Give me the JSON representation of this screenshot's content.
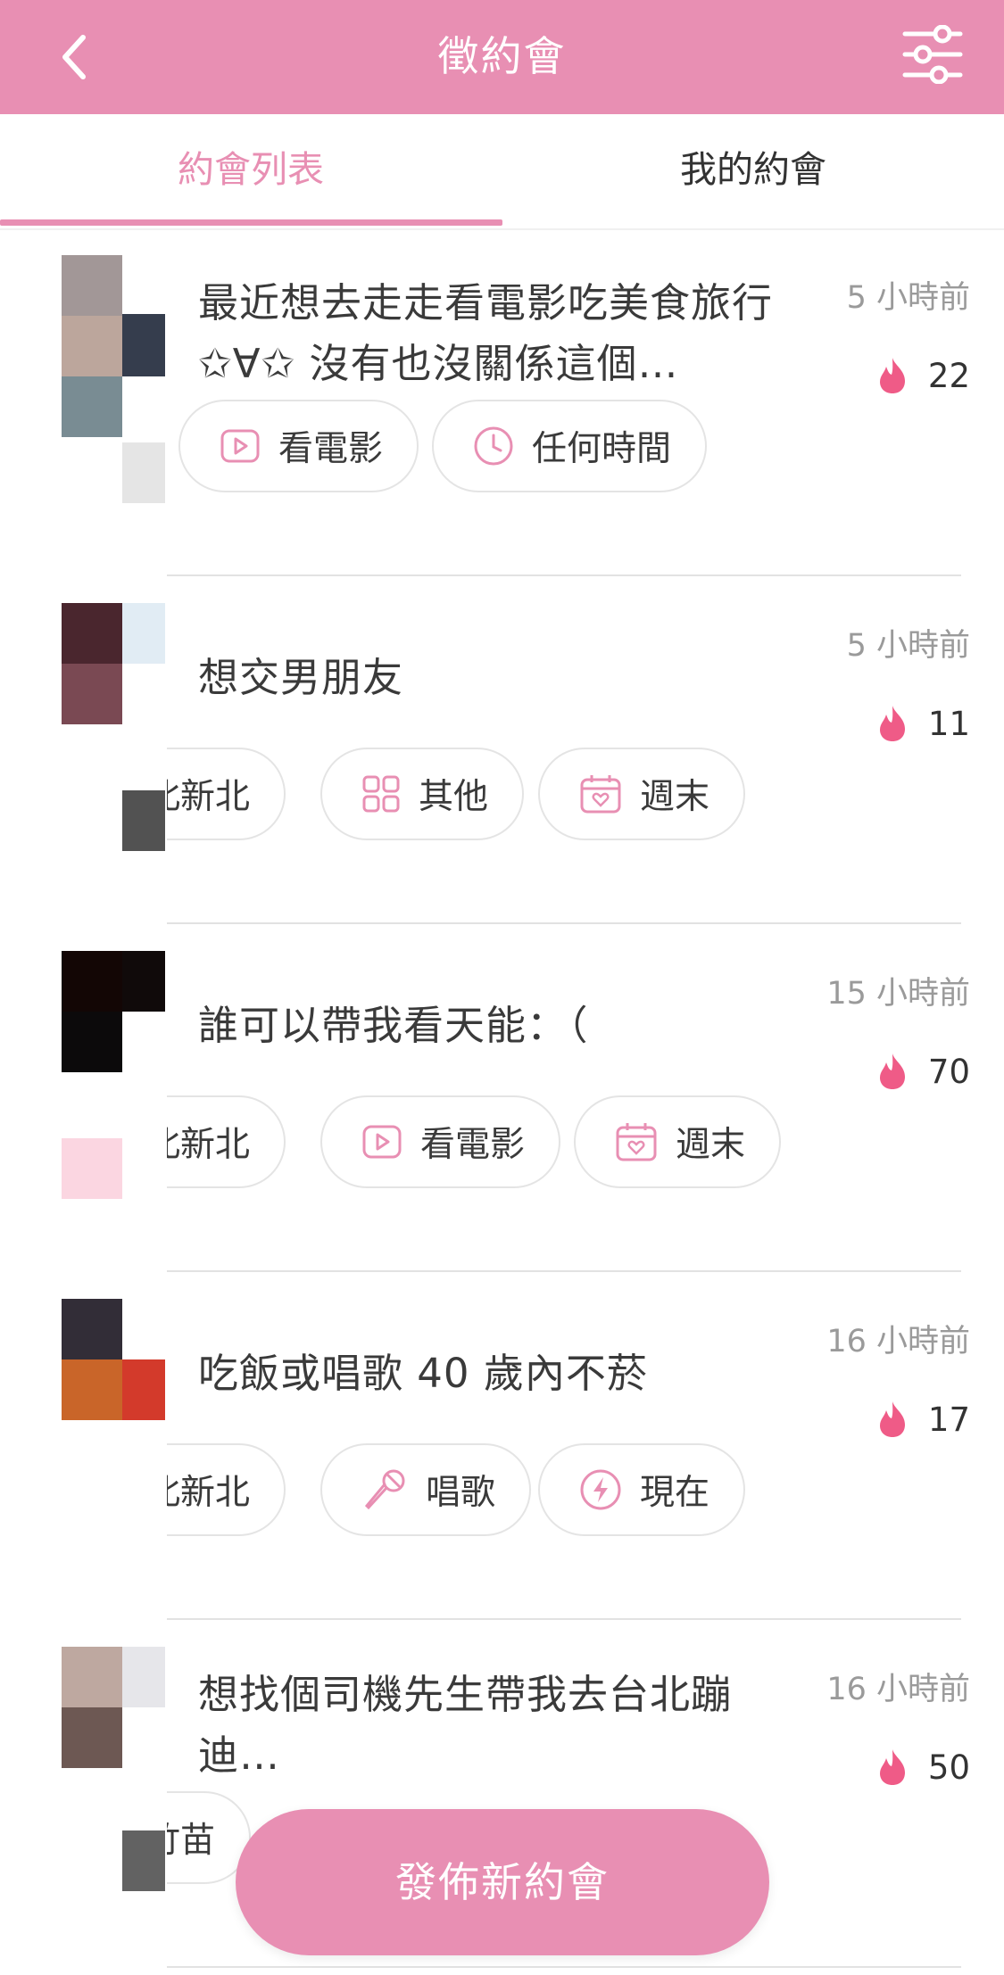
{
  "header": {
    "title": "徵約會",
    "back_icon": "chevron-left-icon",
    "filter_icon": "sliders-icon",
    "color": "#e88fb3"
  },
  "tabs": [
    {
      "label": "約會列表",
      "active": true
    },
    {
      "label": "我的約會",
      "active": false
    }
  ],
  "posts": [
    {
      "title": "最近想去走走看電影吃美食旅行 ✩∀✩ 沒有也沒關係這個…",
      "time": "5 小時前",
      "heat": "22",
      "tags": [
        {
          "label": "看電影",
          "icon": "play-icon"
        },
        {
          "label": "任何時間",
          "icon": "clock-icon"
        }
      ]
    },
    {
      "title": "想交男朋友",
      "time": "5 小時前",
      "heat": "11",
      "tags": [
        {
          "label": "北新北",
          "icon": ""
        },
        {
          "label": "其他",
          "icon": "grid-icon"
        },
        {
          "label": "週末",
          "icon": "calendar-icon"
        }
      ]
    },
    {
      "title": "誰可以帶我看天能：（",
      "time": "15 小時前",
      "heat": "70",
      "tags": [
        {
          "label": "北新北",
          "icon": ""
        },
        {
          "label": "看電影",
          "icon": "play-icon"
        },
        {
          "label": "週末",
          "icon": "calendar-icon"
        }
      ]
    },
    {
      "title": "吃飯或唱歌 40 歲內不菸",
      "time": "16 小時前",
      "heat": "17",
      "tags": [
        {
          "label": "北新北",
          "icon": ""
        },
        {
          "label": "唱歌",
          "icon": "microphone-icon"
        },
        {
          "label": "現在",
          "icon": "lightning-icon"
        }
      ]
    },
    {
      "title": "想找個司機先生帶我去台北蹦迪…",
      "time": "16 小時前",
      "heat": "50",
      "tags": [
        {
          "label": "竹苗",
          "icon": ""
        }
      ]
    }
  ],
  "fab": {
    "label": "發佈新約會"
  }
}
